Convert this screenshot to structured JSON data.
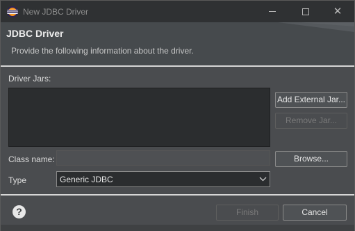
{
  "window": {
    "title": "New JDBC Driver",
    "controls": {
      "minimize": "minimize",
      "maximize": "maximize",
      "close": "✕"
    }
  },
  "header": {
    "title": "JDBC Driver",
    "description": "Provide the following information about the driver."
  },
  "form": {
    "driver_jars_label": "Driver Jars:",
    "add_external_jar_label": "Add External Jar...",
    "remove_jar_label": "Remove Jar...",
    "class_name_label": "Class name:",
    "class_name_value": "",
    "browse_label": "Browse...",
    "type_label": "Type",
    "type_value": "Generic JDBC"
  },
  "footer": {
    "help_label": "?",
    "finish_label": "Finish",
    "cancel_label": "Cancel"
  },
  "icons": {
    "app": "eclipse-icon",
    "help": "help-icon",
    "dropdown": "chevron-down-icon"
  }
}
